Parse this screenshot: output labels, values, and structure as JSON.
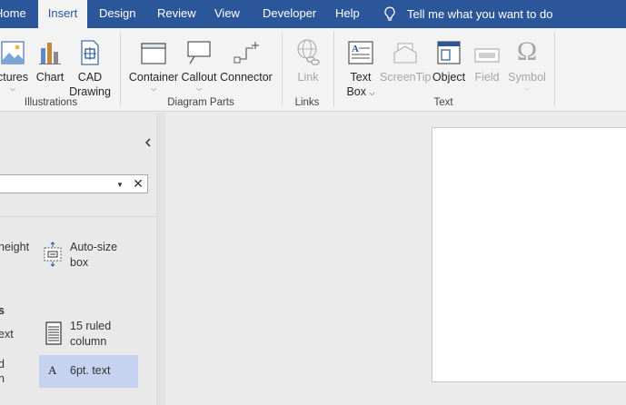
{
  "tabs": [
    {
      "id": "home",
      "label": "Home",
      "active": false
    },
    {
      "id": "insert",
      "label": "Insert",
      "active": true
    },
    {
      "id": "design",
      "label": "Design",
      "active": false
    },
    {
      "id": "review",
      "label": "Review",
      "active": false
    },
    {
      "id": "view",
      "label": "View",
      "active": false
    },
    {
      "id": "developer",
      "label": "Developer",
      "active": false
    },
    {
      "id": "help",
      "label": "Help",
      "active": false
    }
  ],
  "tell_me": {
    "label": "Tell me what you want to do",
    "icon": "lightbulb-icon"
  },
  "ribbon": {
    "groups": {
      "illustrations": "Illustrations",
      "diagram_parts": "Diagram Parts",
      "links": "Links",
      "text": "Text"
    },
    "buttons": {
      "pictures": {
        "label": "ctures",
        "icon": "picture-icon"
      },
      "chart": {
        "label": "Chart",
        "icon": "chart-icon"
      },
      "cad": {
        "label_1": "CAD",
        "label_2": "Drawing",
        "icon": "cad-drawing-icon"
      },
      "container": {
        "label": "Container",
        "icon": "container-icon"
      },
      "callout": {
        "label": "Callout",
        "icon": "callout-icon"
      },
      "connector": {
        "label": "Connector",
        "icon": "connector-icon"
      },
      "link": {
        "label": "Link",
        "icon": "link-icon",
        "disabled": true
      },
      "text_box": {
        "label_1": "Text",
        "label_2": "Box",
        "icon": "text-box-icon"
      },
      "screentip": {
        "label": "ScreenTip",
        "icon": "screentip-icon",
        "disabled": true
      },
      "object": {
        "label": "Object",
        "icon": "object-icon"
      },
      "field": {
        "label": "Field",
        "icon": "field-icon",
        "disabled": true
      },
      "symbol": {
        "label": "Symbol",
        "icon": "omega-icon",
        "glyph": "Ω",
        "disabled": true
      }
    }
  },
  "panel": {
    "items": {
      "height_text": "height",
      "auto_size": {
        "line_1": "Auto-size",
        "line_2": "box",
        "icon": "auto-size-box-icon"
      },
      "section_s": "s",
      "text_partial": "ext",
      "ruled": {
        "line_1": "15 ruled",
        "line_2": "column",
        "icon": "ruled-column-icon"
      },
      "d_partial": "d",
      "n_partial": "n",
      "sixpt": {
        "label": "6pt. text",
        "icon": "text-a-icon",
        "glyph": "A"
      }
    }
  },
  "colors": {
    "accent": "#2b579a",
    "selected": "#c5d3f0",
    "ribbon_bg": "#f3f3f3"
  }
}
